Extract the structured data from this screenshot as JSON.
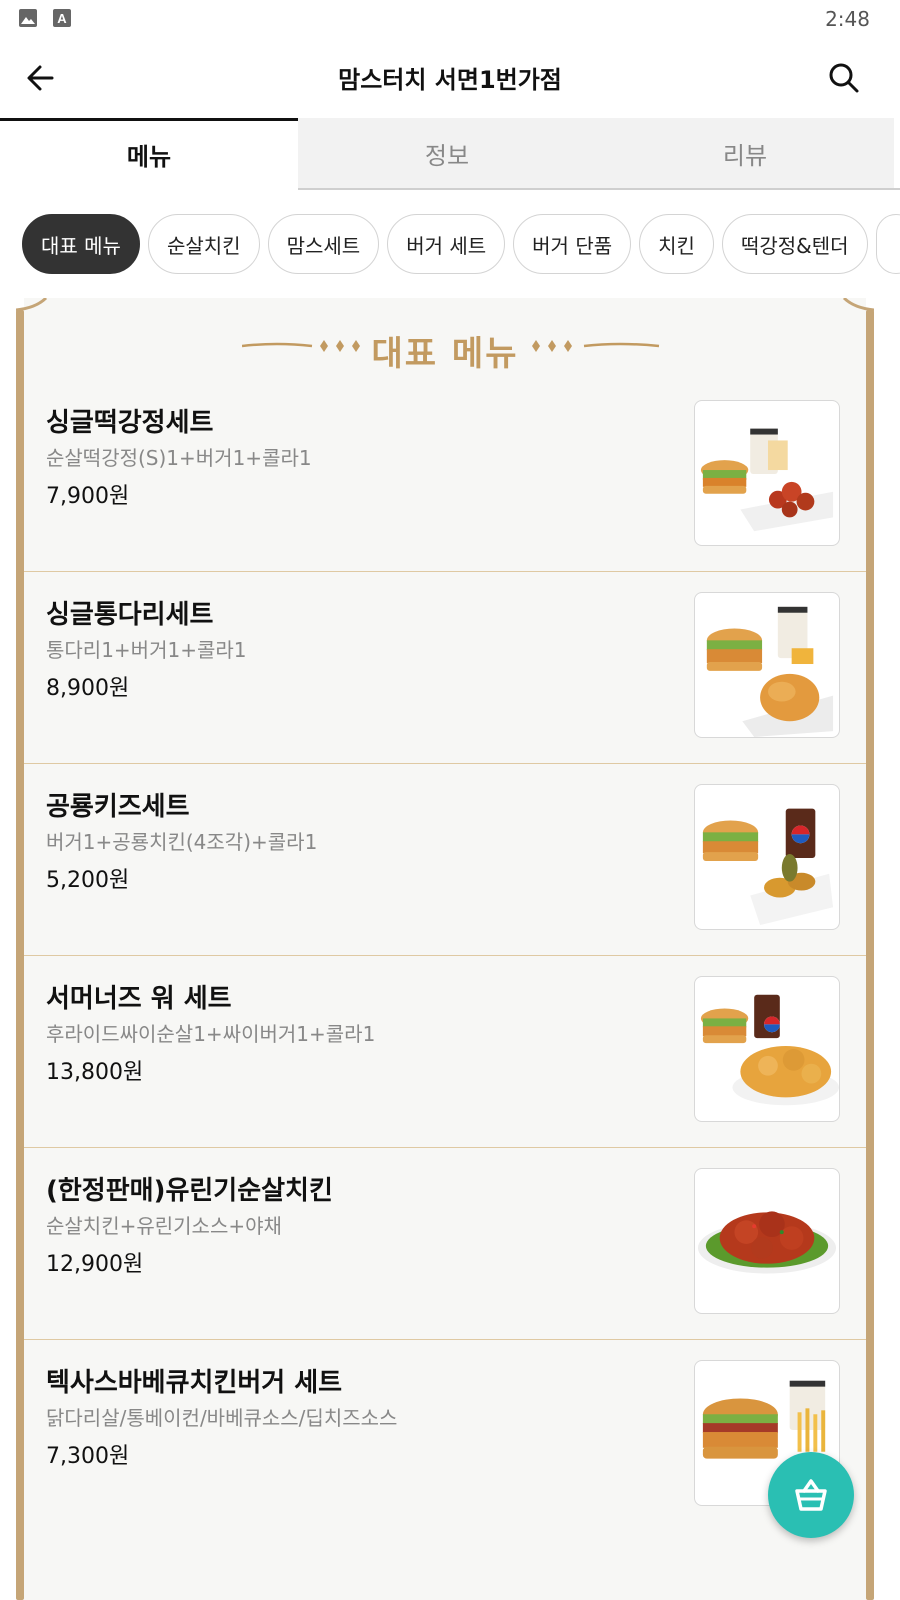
{
  "status_bar": {
    "time": "2:48"
  },
  "app_bar": {
    "title": "맘스터치 서면1번가점"
  },
  "tabs": [
    {
      "label": "메뉴",
      "active": true
    },
    {
      "label": "정보",
      "active": false
    },
    {
      "label": "리뷰",
      "active": false
    }
  ],
  "categories": [
    {
      "label": "대표 메뉴",
      "active": true
    },
    {
      "label": "순살치킨"
    },
    {
      "label": "맘스세트"
    },
    {
      "label": "버거 세트"
    },
    {
      "label": "버거 단품"
    },
    {
      "label": "치킨"
    },
    {
      "label": "떡강정&텐더"
    }
  ],
  "section": {
    "title": "대표 메뉴"
  },
  "menu_items": [
    {
      "name": "싱글떡강정세트",
      "description": "순살떡강정(S)1+버거1+콜라1",
      "price": "7,900원",
      "image": "burger-set-with-tteok-gangjeong"
    },
    {
      "name": "싱글통다리세트",
      "description": "통다리1+버거1+콜라1",
      "price": "8,900원",
      "image": "burger-set-with-drumstick"
    },
    {
      "name": "공룡키즈세트",
      "description": "버거1+공룡치킨(4조각)+콜라1",
      "price": "5,200원",
      "image": "kids-set-with-dino-chicken"
    },
    {
      "name": "서머너즈 워 세트",
      "description": "후라이드싸이순살1+싸이버거1+콜라1",
      "price": "13,800원",
      "image": "burger-set-with-fried-chicken"
    },
    {
      "name": "(한정판매)유린기순살치킨",
      "description": "순살치킨+유린기소스+야채",
      "price": "12,900원",
      "image": "yuringi-chicken-plate"
    },
    {
      "name": "텍사스바베큐치킨버거 세트",
      "description": "닭다리살/통베이컨/바베큐소스/딥치즈소스",
      "price": "7,300원",
      "image": "texas-bbq-burger-set"
    }
  ],
  "colors": {
    "accent_gold": "#c29a60",
    "rail_gold": "#c5a577",
    "chip_active": "#333333",
    "cart_fab": "#2abfb3"
  },
  "icons": [
    "image-icon",
    "font-icon",
    "back-arrow-icon",
    "search-icon",
    "cart-icon"
  ]
}
